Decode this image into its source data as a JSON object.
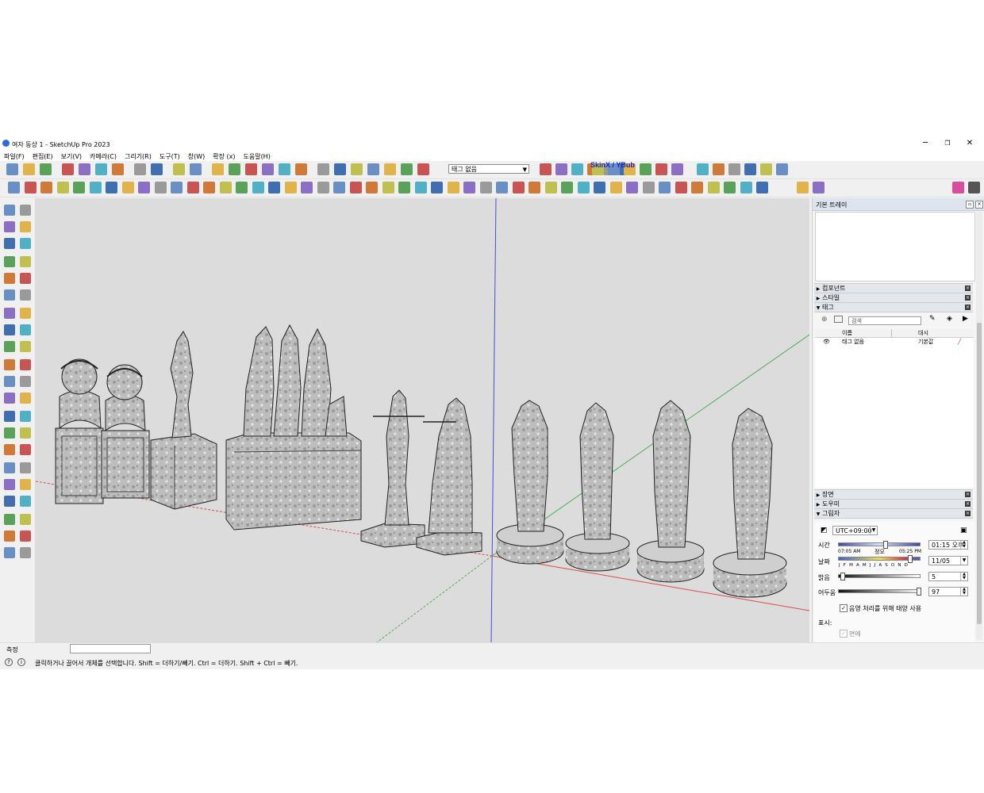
{
  "window": {
    "title": "여자 동상 1 - SketchUp Pro 2023",
    "minimize": "─",
    "maximize": "❐",
    "close": "✕"
  },
  "menu": [
    "파일(F)",
    "편집(E)",
    "보기(V)",
    "카메라(C)",
    "그리기(R)",
    "도구(T)",
    "창(W)",
    "확장 (x)",
    "도움말(H)"
  ],
  "toolbar": {
    "tag_select": "태그 없음",
    "skinx_label": "SkinX / YBub"
  },
  "tray": {
    "title": "기본 트레이",
    "panels": {
      "components": "컴포넌트",
      "styles": "스타일",
      "tags": "태그",
      "scenes": "장면",
      "instructor": "도우미",
      "shadows": "그림자"
    }
  },
  "tags": {
    "search_placeholder": "검색",
    "col_name": "이름",
    "col_dash": "대시",
    "rows": [
      {
        "name": "태그 없음",
        "dash": "기본값"
      }
    ]
  },
  "shadows": {
    "timezone": "UTC+09:00",
    "time_label": "시간",
    "time_start": "07:05 AM",
    "time_noon": "정오",
    "time_end": "05:25 PM",
    "time_value": "01:15 오후",
    "date_label": "날짜",
    "months": "J F M A M J J A S O N D",
    "date_value": "11/05",
    "light_label": "밝음",
    "light_value": "5",
    "dark_label": "어두움",
    "dark_value": "97",
    "sun_shading": "음영 처리를 위해 태양 사용",
    "display_label": "표시:",
    "faces": "면에"
  },
  "measure_label": "측정",
  "status_text": "클릭하거나 끌어서 개체를 선택합니다. Shift = 더하기/빼기. Ctrl = 더하기. Shift + Ctrl = 빼기.",
  "colors": {
    "viewport_bg": "#dcdcdc",
    "axis_red": "#d94c4c",
    "axis_green": "#4caf50",
    "axis_blue": "#4a4ad8",
    "tray_header": "#dde4ee"
  }
}
